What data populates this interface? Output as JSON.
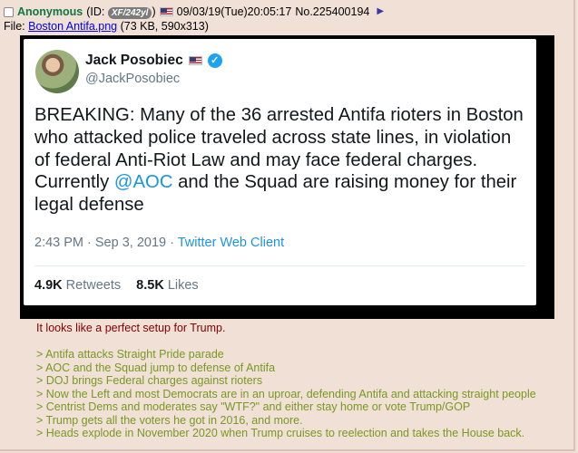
{
  "post": {
    "name": "Anonymous",
    "id_label_pre": "(ID:",
    "id_value": "XF/242yl",
    "id_label_post": ")",
    "datetime": "09/03/19(Tue)20:05:17",
    "post_number": "No.225400194",
    "arrow_icon": "▶",
    "file_label": "File:",
    "file_name": "Boston Antifa.png",
    "file_meta": "(73 KB, 590x313)",
    "comment": "It looks like a perfect setup for Trump.",
    "greentext": [
      "> Antifa attacks Straight Pride parade",
      "> AOC and the Squad jump to defense of Antifa",
      "> DOJ brings Federal charges against rioters",
      "> Now the Left and most Democrats are in an uproar, defending Antifa and attacking straight people",
      "> Centrist Dems and moderates say \"WTF?\" and either stay home or vote Trump/GOP",
      "> Trump gets all the voters he got in 2016, and more.",
      "> Heads explode in November 2020 when Trump cruises to reelection and takes the House back."
    ]
  },
  "tweet": {
    "display_name": "Jack Posobiec",
    "verified_icon": "✓",
    "handle": "@JackPosobiec",
    "text_pre": "BREAKING: Many of the 36 arrested Antifa rioters in Boston who attacked police traveled across state lines, in violation of federal Anti-Riot Law and may face federal charges. Currently ",
    "mention": "@AOC",
    "text_post": " and the Squad are raising money for their legal defense",
    "timestamp": "2:43 PM · Sep 3, 2019 · ",
    "client": "Twitter Web Client",
    "retweets_count": "4.9K",
    "retweets_label": "Retweets",
    "likes_count": "8.5K",
    "likes_label": "Likes"
  },
  "colors": {
    "background": "#f0e0d6",
    "name_green": "#117743",
    "comment_maroon": "#800000",
    "greentext": "#789922",
    "link_blue": "#0000ee",
    "twitter_blue": "#1da1f2"
  }
}
